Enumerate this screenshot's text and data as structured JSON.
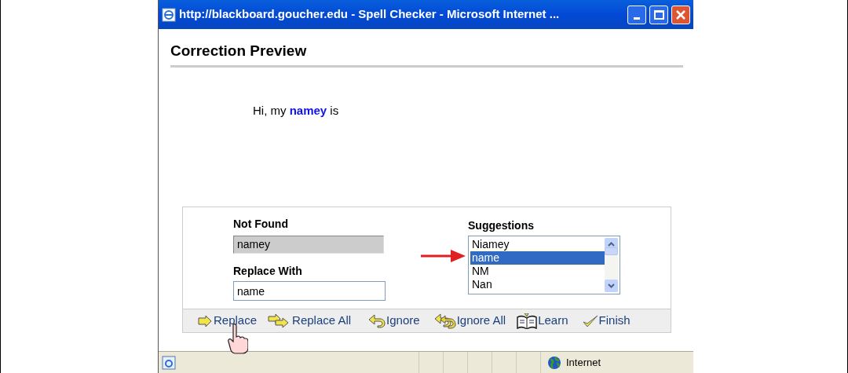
{
  "window": {
    "title": "http://blackboard.goucher.edu - Spell Checker - Microsoft Internet ..."
  },
  "heading": "Correction Preview",
  "preview": "Hi, my **namey** is",
  "not_found": {
    "label": "Not Found",
    "value": "namey"
  },
  "replace_with": {
    "label": "Replace With",
    "value": "name"
  },
  "suggestions": {
    "label": "Suggestions",
    "items": [
      {
        "text": "Niamey",
        "selected": false
      },
      {
        "text": "name",
        "selected": true
      },
      {
        "text": "NM",
        "selected": false
      },
      {
        "text": "Nan",
        "selected": false
      }
    ]
  },
  "buttons": [
    {
      "label": "Replace",
      "kind": "replace"
    },
    {
      "label": "Replace All",
      "kind": "replace-all"
    },
    {
      "label": "Ignore",
      "kind": "ignore"
    },
    {
      "label": "Ignore All",
      "kind": "ignore-all"
    },
    {
      "label": "Learn",
      "kind": "learn"
    },
    {
      "label": "Finish",
      "kind": "finish"
    }
  ],
  "status_bar": {
    "zone": "Internet"
  }
}
